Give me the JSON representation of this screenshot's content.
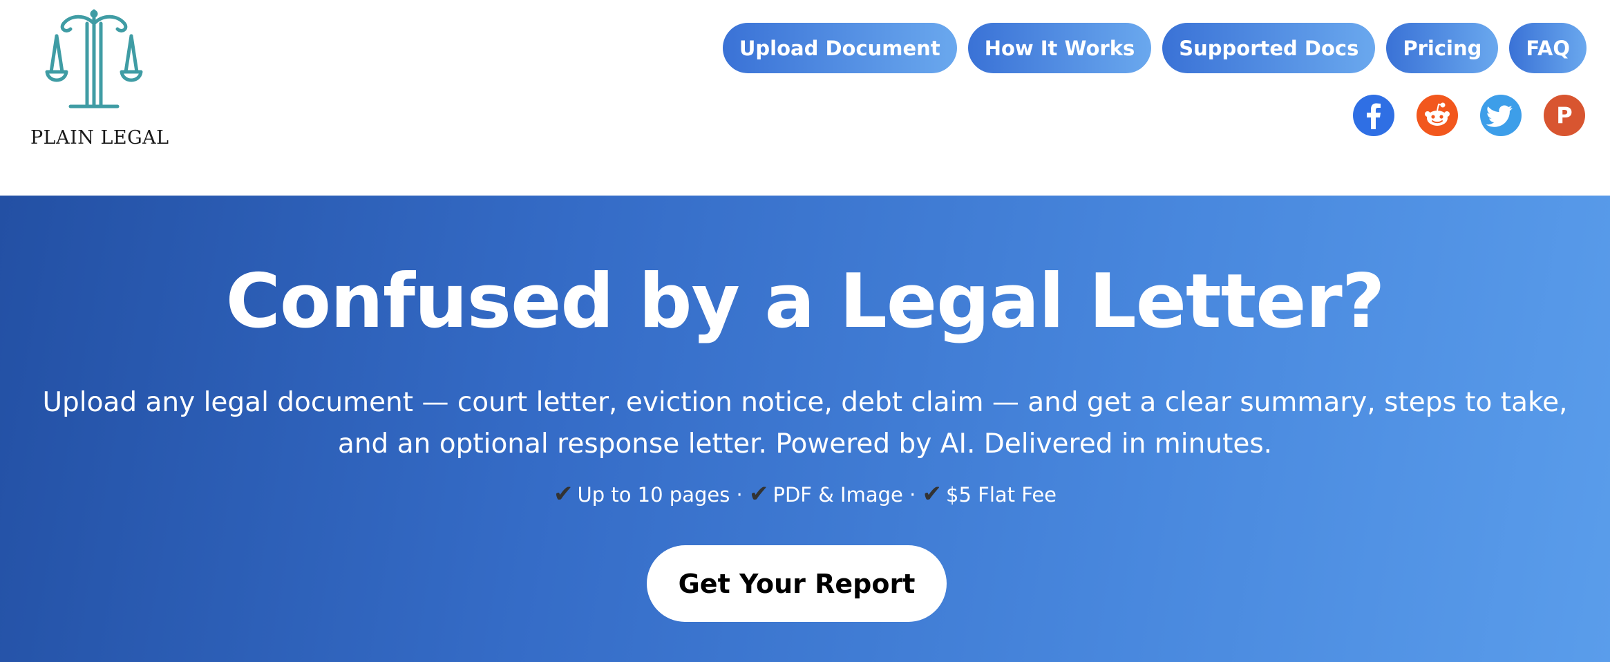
{
  "brand": {
    "logo_text": "PLAIN LEGAL",
    "logo_icon": "scales-of-justice-icon",
    "logo_color": "#3f9ca4"
  },
  "nav": {
    "items": [
      {
        "label": "Upload Document"
      },
      {
        "label": "How It Works"
      },
      {
        "label": "Supported Docs"
      },
      {
        "label": "Pricing"
      },
      {
        "label": "FAQ"
      }
    ],
    "pill_gradient": [
      "#3a72d6",
      "#6aa8ee"
    ]
  },
  "socials": [
    {
      "icon": "facebook-icon",
      "color": "#2f6fe4"
    },
    {
      "icon": "reddit-icon",
      "color": "#f2571d"
    },
    {
      "icon": "twitter-icon",
      "color": "#3d9ee9"
    },
    {
      "icon": "producthunt-icon",
      "color": "#d85530",
      "glyph": "P"
    }
  ],
  "hero": {
    "title": "Confused by a Legal Letter?",
    "subtitle_line1": "Upload any legal document — court letter, eviction notice, debt claim — and get a clear summary, steps to take,",
    "subtitle_line2": "and an optional response letter. Powered by AI. Delivered in minutes.",
    "check_glyph": "✔",
    "separator": " · ",
    "features": [
      {
        "label": "Up to 10 pages"
      },
      {
        "label": "PDF & Image"
      },
      {
        "label": "$5 Flat Fee"
      }
    ],
    "cta_label": "Get Your Report",
    "gradient": [
      "#2350a4",
      "#5a9deb"
    ]
  }
}
